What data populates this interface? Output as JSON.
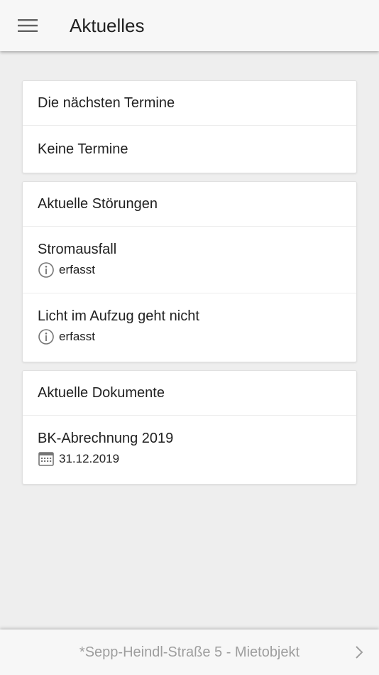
{
  "appbar": {
    "title": "Aktuelles",
    "menu_icon": "hamburger-menu-icon"
  },
  "cards": {
    "termine": {
      "header": "Die nächsten Termine",
      "empty_text": "Keine Termine"
    },
    "stoerungen": {
      "header": "Aktuelle Störungen",
      "items": [
        {
          "title": "Stromausfall",
          "status": "erfasst",
          "icon": "info-icon"
        },
        {
          "title": "Licht im Aufzug geht nicht",
          "status": "erfasst",
          "icon": "info-icon"
        }
      ]
    },
    "dokumente": {
      "header": "Aktuelle Dokumente",
      "items": [
        {
          "title": "BK-Abrechnung 2019",
          "date": "31.12.2019",
          "icon": "calendar-icon"
        }
      ]
    }
  },
  "bottom_bar": {
    "label": "*Sepp-Heindl-Straße 5 - Mietobjekt",
    "icon": "chevron-right-icon"
  },
  "colors": {
    "background": "#eeeeee",
    "appbar": "#f7f7f7",
    "card": "#ffffff",
    "text": "#212121",
    "muted_text": "#9e9e9e",
    "icon_gray": "#757575"
  }
}
